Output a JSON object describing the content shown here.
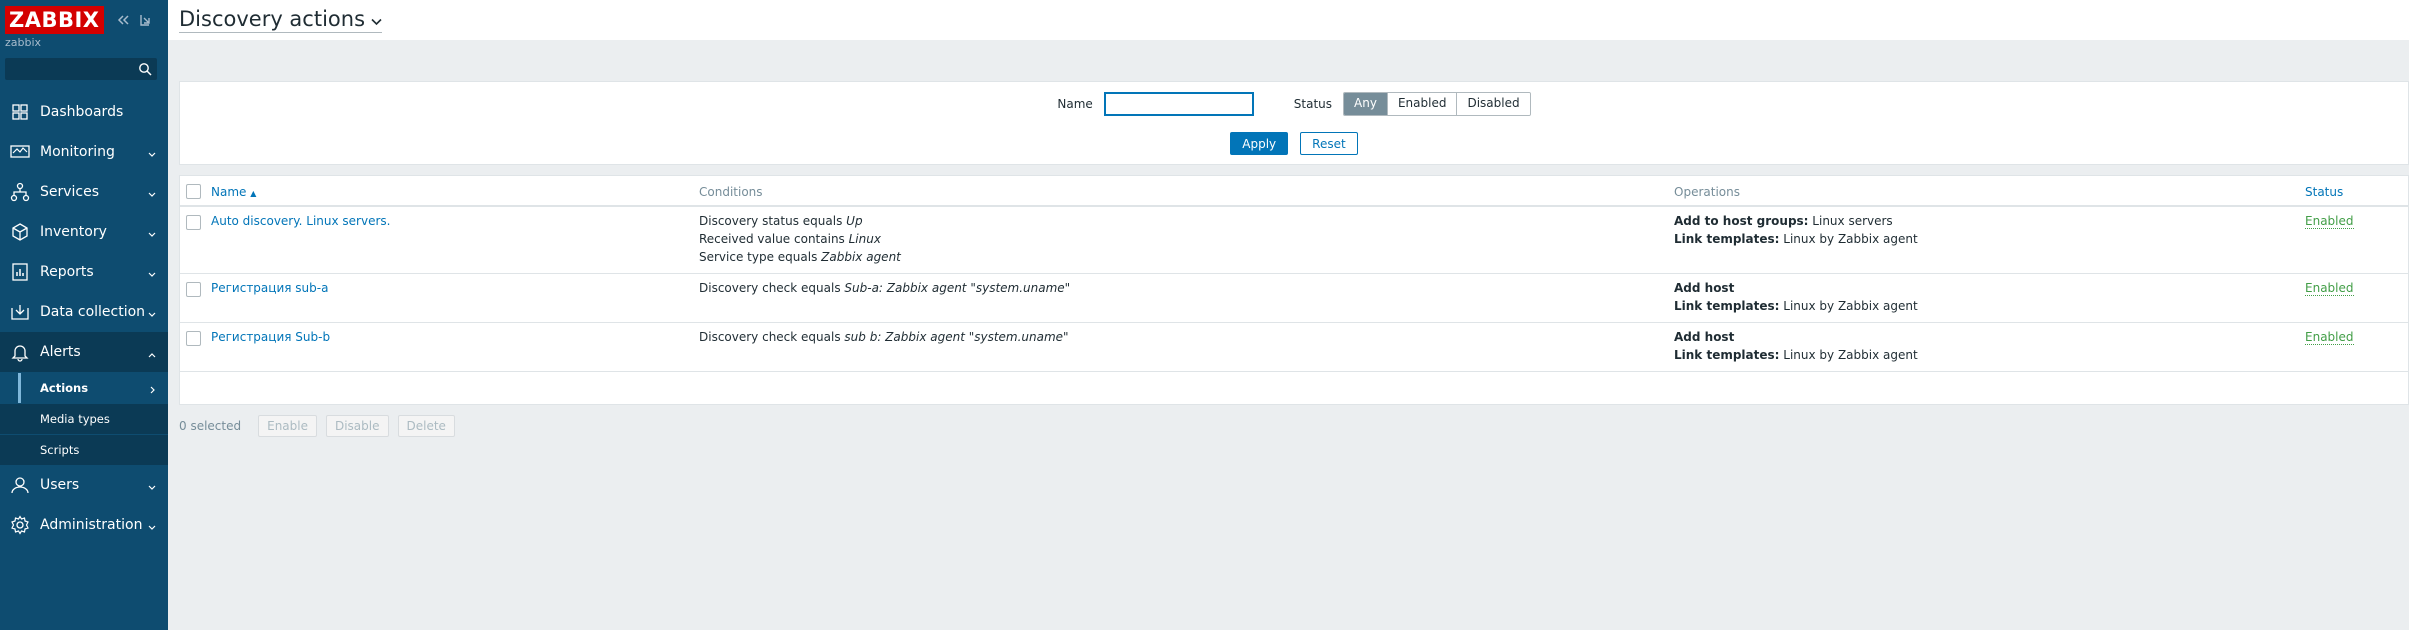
{
  "app": {
    "logo_text": "ZABBIX",
    "server_name": "zabbix",
    "search_placeholder": ""
  },
  "sidebar": {
    "items": [
      {
        "label": "Dashboards",
        "icon": "dashboard-icon"
      },
      {
        "label": "Monitoring",
        "icon": "monitoring-icon"
      },
      {
        "label": "Services",
        "icon": "services-icon"
      },
      {
        "label": "Inventory",
        "icon": "inventory-icon"
      },
      {
        "label": "Reports",
        "icon": "reports-icon"
      },
      {
        "label": "Data collection",
        "icon": "data-collection-icon"
      },
      {
        "label": "Alerts",
        "icon": "bell-icon"
      },
      {
        "label": "Users",
        "icon": "user-icon"
      },
      {
        "label": "Administration",
        "icon": "gear-icon"
      }
    ],
    "alerts_submenu": [
      {
        "label": "Actions"
      },
      {
        "label": "Media types"
      },
      {
        "label": "Scripts"
      }
    ]
  },
  "header": {
    "title": "Discovery actions"
  },
  "filter": {
    "name_label": "Name",
    "name_value": "",
    "status_label": "Status",
    "status_options": [
      "Any",
      "Enabled",
      "Disabled"
    ],
    "status_selected": "Any",
    "apply_label": "Apply",
    "reset_label": "Reset"
  },
  "table": {
    "columns": {
      "name": "Name",
      "conditions": "Conditions",
      "operations": "Operations",
      "status": "Status"
    },
    "sort_arrow": "▲",
    "rows": [
      {
        "name": "Auto discovery. Linux servers.",
        "conditions": [
          {
            "text": "Discovery status equals ",
            "value": "Up"
          },
          {
            "text": "Received value contains ",
            "value": "Linux"
          },
          {
            "text": "Service type equals ",
            "value": "Zabbix agent"
          }
        ],
        "operations": [
          {
            "key": "Add to host groups:",
            "value": " Linux servers"
          },
          {
            "key": "Link templates:",
            "value": " Linux by Zabbix agent"
          }
        ],
        "status": "Enabled"
      },
      {
        "name": "Регистрация sub-a",
        "conditions": [
          {
            "text": "Discovery check equals ",
            "value": "Sub-a: Zabbix agent \"system.uname\""
          }
        ],
        "operations": [
          {
            "key": "Add host",
            "value": ""
          },
          {
            "key": "Link templates:",
            "value": " Linux by Zabbix agent"
          }
        ],
        "status": "Enabled"
      },
      {
        "name": "Регистрация Sub-b",
        "conditions": [
          {
            "text": "Discovery check equals ",
            "value": "sub b: Zabbix agent \"system.uname\""
          }
        ],
        "operations": [
          {
            "key": "Add host",
            "value": ""
          },
          {
            "key": "Link templates:",
            "value": " Linux by Zabbix agent"
          }
        ],
        "status": "Enabled"
      }
    ]
  },
  "bulk": {
    "selected_text": "0 selected",
    "enable_label": "Enable",
    "disable_label": "Disable",
    "delete_label": "Delete"
  },
  "colors": {
    "sidebar_bg": "#0e4c70",
    "accent": "#0275b8",
    "logo_red": "#d40000",
    "enabled_green": "#429e47"
  }
}
